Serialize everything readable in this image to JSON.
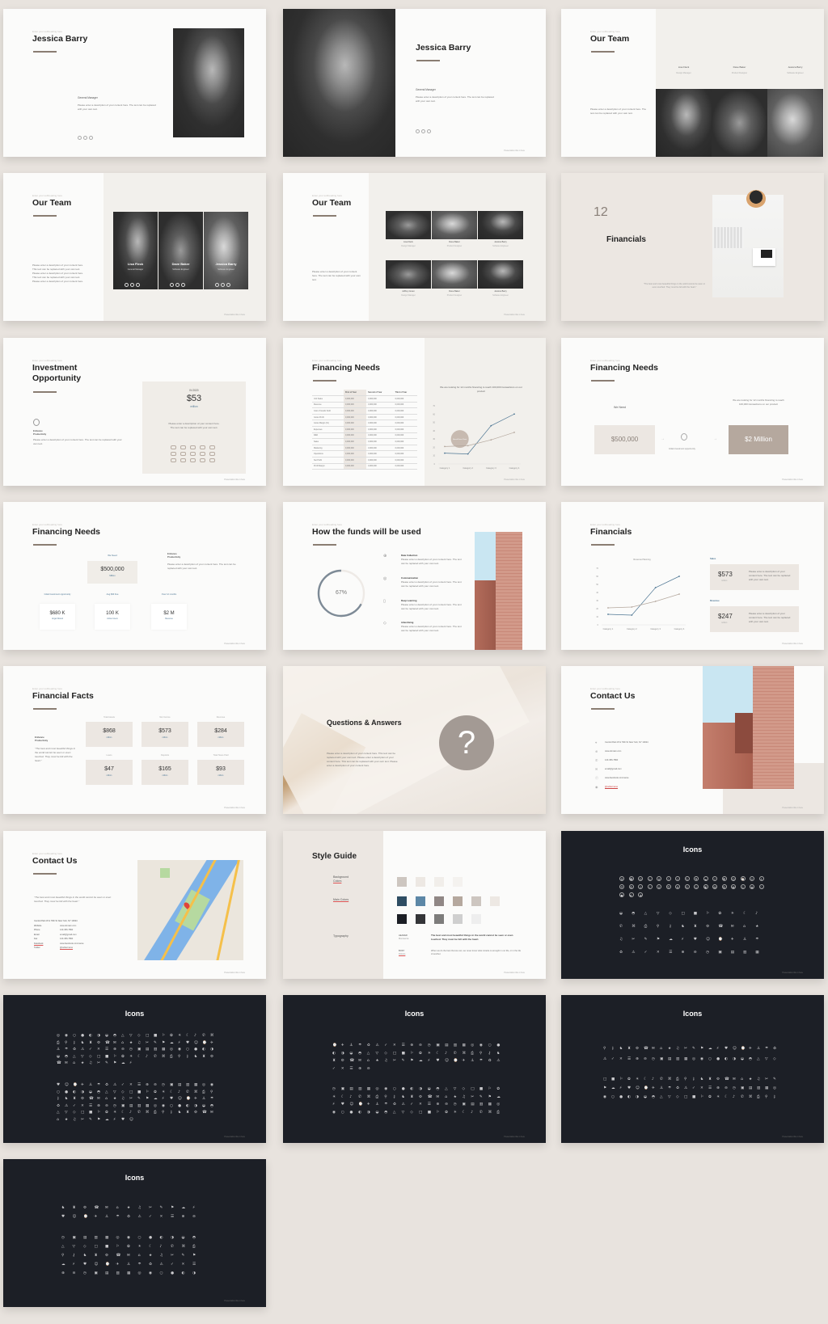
{
  "common": {
    "subheading": "Enter your subheading here",
    "footer": "Presentation title in here",
    "desc": "Please enter a description of your content here. This text can be replaced with your own text. Please enter a description of your content here. This text can be replaced with your own text. Please enter a description of your content here.",
    "desc_short": "Please enter a description of your content here. The text can be replaced with your own text.",
    "quote": "\"The best and most beautiful things in the world cannot be seen or even touched. They must be felt with the heart.\""
  },
  "colors": {
    "background": "#e8e3de",
    "accent": "#8a7d72",
    "beige": "#ece7e2",
    "dark": "#1c1f26",
    "blue": "#4f7794",
    "tan": "#b5a89e"
  },
  "s": {
    "jb1": {
      "title": "Jessica Barry",
      "role": "General Manager"
    },
    "jb2": {
      "title": "Jessica Barry",
      "role": "General Manager"
    },
    "team1": {
      "title": "Our Team",
      "members": [
        {
          "name": "Lisa Fleck",
          "role": "Design Manager"
        },
        {
          "name": "Dave Baker",
          "role": "Product Designer"
        },
        {
          "name": "Jessica Barry",
          "role": "Software Engineer"
        }
      ]
    },
    "team2": {
      "title": "Our Team",
      "members": [
        {
          "name": "Lisa Fleck",
          "role": "General Manager"
        },
        {
          "name": "Dave Baker",
          "role": "Software Engineer"
        },
        {
          "name": "Jessica Barry",
          "role": "Software Engineer"
        }
      ]
    },
    "team3": {
      "title": "Our Team",
      "members": [
        {
          "name": "Lisa Fleck",
          "role": "Design Manager"
        },
        {
          "name": "Dave Baker",
          "role": "Product Designer"
        },
        {
          "name": "Jessica Barry",
          "role": "Software Engineer"
        },
        {
          "name": "Jeffrey Green",
          "role": "Design Manager"
        },
        {
          "name": "Dave Baker",
          "role": "Product Designer"
        },
        {
          "name": "Jessica Barry",
          "role": "Software Engineer"
        }
      ]
    },
    "finsec": {
      "number": "12",
      "title": "Financials"
    },
    "invest": {
      "title_1": "Investment",
      "title_2": "Opportunity",
      "feature": "Enhance Productivity",
      "year": "IN 2020",
      "amount": "$53",
      "unit": "million"
    },
    "fneeds1": {
      "title": "Financing Needs",
      "table": {
        "headers": [
          "",
          "First of Year",
          "Second of Year",
          "Third of Year"
        ],
        "rows": [
          [
            "Unit Sales",
            "0,000,000",
            "0,000,000",
            "0,000,000"
          ],
          [
            "Revenue",
            "0,000,000",
            "0,000,000",
            "0,000,000"
          ],
          [
            "Cost of Goods Sold",
            "0,000,000",
            "0,000,000",
            "0,000,000"
          ],
          [
            "Gross Profit",
            "0,000,000",
            "0,000,000",
            "0,000,000"
          ],
          [
            "Gross Margin (%)",
            "0,000,000",
            "0,000,000",
            "0,000,000"
          ],
          [
            "Expenses",
            "0,000,000",
            "0,000,000",
            "0,000,000"
          ],
          [
            "R&D",
            "0,000,000",
            "0,000,000",
            "0,000,000"
          ],
          [
            "Sales",
            "0,000,000",
            "0,000,000",
            "0,000,000"
          ],
          [
            "Marketing",
            "0,000,000",
            "0,000,000",
            "0,000,000"
          ],
          [
            "Operations",
            "0,000,000",
            "0,000,000",
            "0,000,000"
          ],
          [
            "Net Profit",
            "0,000,000",
            "0,000,000",
            "0,000,000"
          ],
          [
            "Profit Margin",
            "0,000,000",
            "0,000,000",
            "0,000,000"
          ]
        ]
      },
      "chart_title": "We are looking for 12 months financing to reach 100,000 transactions on our product",
      "chart": {
        "type": "line",
        "categories": [
          "Category 1",
          "Category 2",
          "Category 3",
          "Category 4"
        ],
        "ylim": [
          0,
          70
        ],
        "yticks": [
          0,
          10,
          20,
          30,
          40,
          50,
          60,
          70
        ],
        "series": [
          {
            "values": [
              13,
              12,
              46,
              60
            ],
            "color": "#4f7794"
          },
          {
            "values": [
              21,
              22,
              29,
              38
            ],
            "color": "#b5a89e"
          }
        ],
        "annotation": "Break Even Point"
      }
    },
    "fneeds2": {
      "title": "Financing Needs",
      "we_need": "We Need",
      "amount": "$500,000",
      "middle": "Initial investment opportunity",
      "note": "We are looking for 12 months financing to reach 100,000 transactions on our product",
      "target": "$2 Million"
    },
    "fneeds3": {
      "title": "Financing Needs",
      "we_need": "We Need",
      "amount": "$500,000",
      "unit": "Million",
      "feature": "Enhance Productivity",
      "labels": [
        "Initial investment opportunity",
        "Aug $30 free",
        "Over 12 months"
      ],
      "cards": [
        {
          "value": "$680 K",
          "label": "Angel Round"
        },
        {
          "value": "100 K",
          "label": "Active Users"
        },
        {
          "value": "$2 M",
          "label": "Revenue"
        }
      ]
    },
    "funds": {
      "title": "How the funds will be used",
      "percent": "67%",
      "progress": 67,
      "items": [
        "Data Collection",
        "Communication",
        "Deep Learning",
        "Advertising"
      ]
    },
    "fin2": {
      "title": "Financials",
      "chart_title": "Revenue Planning",
      "sales_label": "Sales",
      "sales": "$573",
      "revenue_label": "Revenue",
      "revenue": "$247",
      "unit": "million",
      "chart": {
        "type": "line",
        "categories": [
          "Category 1",
          "Category 2",
          "Category 3",
          "Category 4"
        ],
        "ylim": [
          0,
          70
        ],
        "yticks": [
          0,
          10,
          20,
          30,
          40,
          50,
          60,
          70
        ],
        "series": [
          {
            "values": [
              13,
              12,
              46,
              60
            ],
            "color": "#4f7794"
          },
          {
            "values": [
              21,
              22,
              29,
              38
            ],
            "color": "#b5a89e"
          }
        ]
      }
    },
    "facts": {
      "title": "Financial Facts",
      "feature": "Enhance Productivity",
      "unit": "million",
      "items": [
        {
          "label": "Total Assets",
          "value": "$868"
        },
        {
          "label": "Net Income",
          "value": "$573"
        },
        {
          "label": "Revenue",
          "value": "$284"
        },
        {
          "label": "Loans",
          "value": "$47"
        },
        {
          "label": "Deposits",
          "value": "$165"
        },
        {
          "label": "Total Taxes Paid",
          "value": "$93"
        }
      ]
    },
    "qa": {
      "title": "Questions & Answers",
      "mark": "?"
    },
    "contact1": {
      "title": "Contact Us",
      "items": [
        "Central Park W & 79th St New York, NY 10024",
        "www.domain.com",
        "123-456-7890",
        "email@gmail.com",
        "www.facebook.com/name",
        "@twittername"
      ]
    },
    "contact2": {
      "title": "Contact Us",
      "address": "Central Park W & 79th St New York, NY 10024",
      "rows": [
        {
          "label": "Website",
          "value": "www.domain.com"
        },
        {
          "label": "Phone",
          "value": "123-456-7890"
        },
        {
          "label": "Email",
          "value": "email@gmail.com"
        },
        {
          "label": "Fax",
          "value": "123-456-7890"
        },
        {
          "label": "Facebook",
          "value": "www.facebook.com/name"
        },
        {
          "label": "Twitter",
          "value": "@twittername"
        }
      ]
    },
    "style": {
      "title": "Style Guide",
      "bg_label_1": "Background",
      "bg_label_2": "Colors",
      "main_label": "Main Colors",
      "typo_label": "Typography",
      "bg_colors": [
        "#cdc6c0",
        "#ede8e3",
        "#f1eeea",
        "#f4f2ef"
      ],
      "main_colors": [
        "#2e4d63",
        "#5c87a6",
        "#908785",
        "#b5a89e",
        "#cdc6c0",
        "#ede8e3"
      ],
      "main_colors_2": [
        "#1b1e25",
        "#343538",
        "#7d7c7b",
        "#cfcfcf",
        "#eeeeee"
      ],
      "header_label": "HEADER",
      "header_font": "Montserrat",
      "body_label": "BODY",
      "body_font": "Roboto",
      "header_sample": "The best and most beautiful things in the world cannot be seen or even touched. They must be felt with the heart.",
      "body_sample": "When we do the best that we can, we never know what miracle is wrought in our life, or in the life of another."
    },
    "icons": {
      "title": "Icons",
      "glyphs": "⚙☎✉⌂★♫✂✎⚑☁⚡♥☺⌚✈⚓☂♻⚠✓✕☰⊕⊖◷▣▤▥▦◎◉○●◐◑◒◓△▽◇□■⚐✿☀☾♪✆⌘⎙⚲⚷♞♜"
    }
  }
}
